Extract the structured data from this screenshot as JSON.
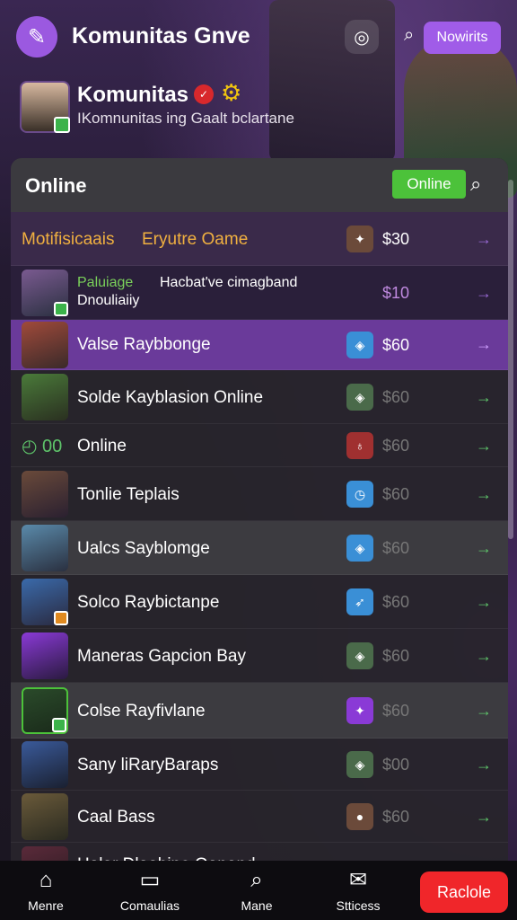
{
  "colors": {
    "accent": "#a05ce8",
    "online": "#4cc23a",
    "cta": "#f0262a",
    "gold": "#f1c40f",
    "arrow": "#5ec46a"
  },
  "header": {
    "title": "Komunitas Gnve",
    "pill_label": "Nowirits",
    "logo_icon": "wrench-icon",
    "menu_icon": "controller-icon",
    "search_icon": "search-icon"
  },
  "profile": {
    "name": "Komunitas",
    "subtitle": "IKomnunitas  ing Gaalt bclartane"
  },
  "panel": {
    "title": "Online",
    "online_button": "Online"
  },
  "rows": [
    {
      "name": "Motifisicaais",
      "name2": "Eryutre Oame",
      "price": "$30",
      "tag_icon": "brush-icon",
      "tag_color": "#6b4a3a"
    },
    {
      "name": "Paluiage",
      "name_rest": "Hacbat've cimagband",
      "line2": "Dnouliaiiy",
      "price": "$10"
    },
    {
      "name": "Valse Raybbonge",
      "price": "$60",
      "tag_icon": "shield-icon",
      "tag_color": "#3a8fd6"
    },
    {
      "name": "Solde Kayblasion Online",
      "price": "$60",
      "tag_icon": "shield-icon",
      "tag_color": "#4a6a4a"
    },
    {
      "name": "Online",
      "lead": "00",
      "price": "$60",
      "tag_icon": "potion-icon",
      "tag_color": "#a03030"
    },
    {
      "name": "Tonlie Teplais",
      "price": "$60",
      "tag_icon": "timer-icon",
      "tag_color": "#3a8fd6"
    },
    {
      "name": "Ualcs Sayblomge",
      "price": "$60",
      "tag_icon": "shield-icon",
      "tag_color": "#3a8fd6"
    },
    {
      "name": "Solco Raybictanpe",
      "price": "$60",
      "tag_icon": "rocket-icon",
      "tag_color": "#3a8fd6"
    },
    {
      "name": "Maneras Gapcion Bay",
      "price": "$60",
      "tag_icon": "shield-icon",
      "tag_color": "#4a6a4a"
    },
    {
      "name": "Colse Rayfivlane",
      "price": "$60",
      "tag_icon": "brush-icon",
      "tag_color": "#8a3ad6"
    },
    {
      "name": "Sany liRaryBaraps",
      "price": "$00",
      "tag_icon": "shield-icon",
      "tag_color": "#4a6a4a"
    },
    {
      "name": "Caal Bass",
      "price": "$60",
      "tag_icon": "bomb-icon",
      "tag_color": "#6b4a3a"
    },
    {
      "name": "Halar Dlaabine Oanand",
      "price": "",
      "tag_icon": "",
      "tag_color": "#444"
    }
  ],
  "nav": [
    {
      "label": "Menre",
      "icon": "home-icon"
    },
    {
      "label": "Comaulias",
      "icon": "chat-icon"
    },
    {
      "label": "Mane",
      "icon": "search-icon"
    },
    {
      "label": "Stticess",
      "icon": "mail-icon"
    }
  ],
  "cta_label": "Raclole"
}
